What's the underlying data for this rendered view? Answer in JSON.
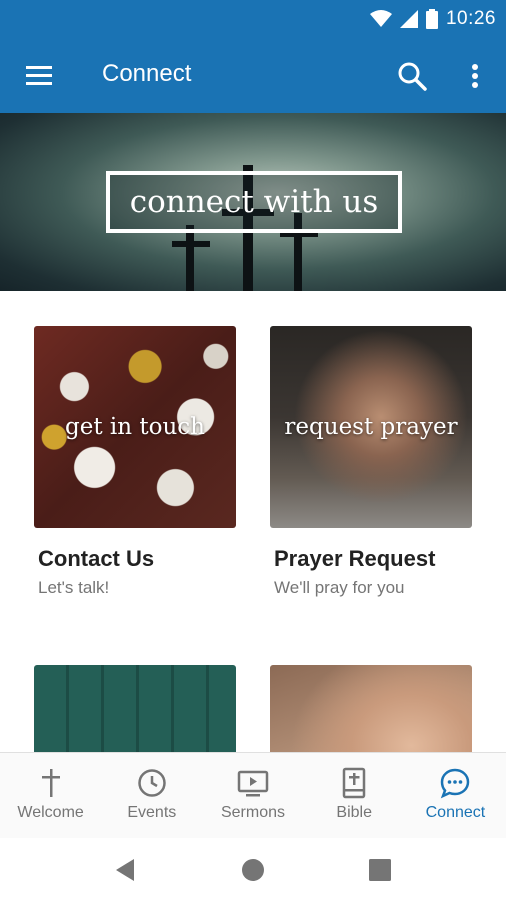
{
  "status_bar": {
    "time": "10:26"
  },
  "app_bar": {
    "title": "Connect"
  },
  "hero": {
    "banner_text": "connect with us"
  },
  "cards": [
    {
      "image_text": "get in touch",
      "title": "Contact Us",
      "subtitle": "Let's talk!"
    },
    {
      "image_text": "request prayer",
      "title": "Prayer Request",
      "subtitle": "We'll pray for you"
    }
  ],
  "bottom_nav": {
    "items": [
      {
        "label": "Welcome",
        "icon": "cross-icon"
      },
      {
        "label": "Events",
        "icon": "clock-icon"
      },
      {
        "label": "Sermons",
        "icon": "video-icon"
      },
      {
        "label": "Bible",
        "icon": "bible-icon"
      },
      {
        "label": "Connect",
        "icon": "chat-icon",
        "active": true
      }
    ]
  },
  "colors": {
    "primary": "#1a73b4",
    "inactive": "#757575"
  }
}
